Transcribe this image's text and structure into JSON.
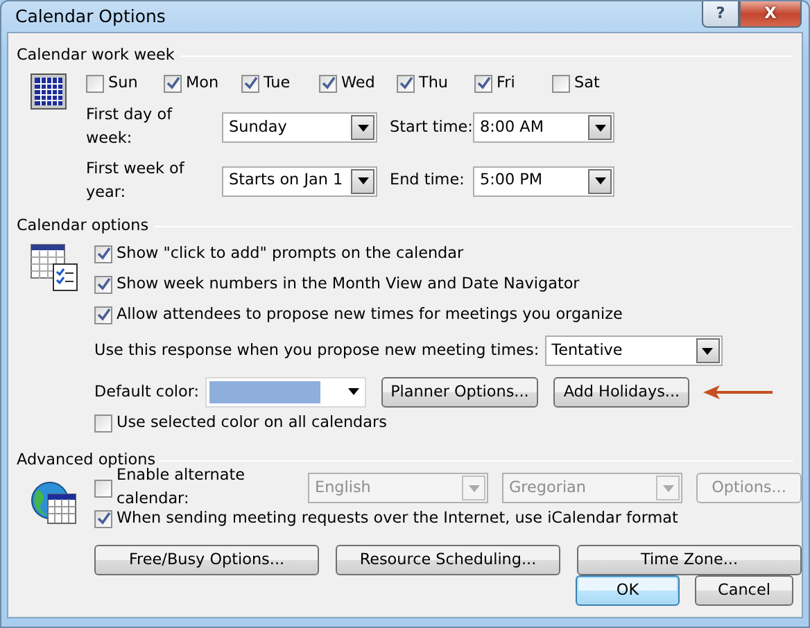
{
  "window": {
    "title": "Calendar Options",
    "help_glyph": "?",
    "close_glyph": "X"
  },
  "work_week": {
    "title": "Calendar work week",
    "days": [
      {
        "label": "Sun",
        "checked": false
      },
      {
        "label": "Mon",
        "checked": true
      },
      {
        "label": "Tue",
        "checked": true
      },
      {
        "label": "Wed",
        "checked": true
      },
      {
        "label": "Thu",
        "checked": true
      },
      {
        "label": "Fri",
        "checked": true
      },
      {
        "label": "Sat",
        "checked": false
      }
    ],
    "fields": [
      {
        "label": "First day of week:",
        "value": "Sunday"
      },
      {
        "label": "Start time:",
        "value": "8:00 AM"
      },
      {
        "label": "First week of year:",
        "value": "Starts on Jan 1"
      },
      {
        "label": "End time:",
        "value": "5:00 PM"
      }
    ]
  },
  "calendar_options": {
    "title": "Calendar options",
    "checks": [
      {
        "label": "Show \"click to add\" prompts on the calendar",
        "checked": true
      },
      {
        "label": "Show week numbers in the Month View and Date Navigator",
        "checked": true
      },
      {
        "label": "Allow attendees to propose new times for meetings you organize",
        "checked": true
      }
    ],
    "response": {
      "label": "Use this response when you propose new meeting times:",
      "value": "Tentative"
    },
    "default_color": {
      "label": "Default color:",
      "color": "#8eaedc"
    },
    "buttons": [
      "Planner Options...",
      "Add Holidays..."
    ],
    "use_selected": {
      "label": "Use selected color on all calendars",
      "checked": false
    }
  },
  "advanced": {
    "title": "Advanced options",
    "alternate": {
      "label": "Enable alternate calendar:",
      "checked": false,
      "disabled": true,
      "language": "English",
      "calendar": "Gregorian",
      "options_button": "Options..."
    },
    "icalendar": {
      "label": "When sending meeting requests over the Internet, use iCalendar format",
      "checked": true
    },
    "buttons": [
      "Free/Busy Options...",
      "Resource Scheduling...",
      "Time Zone..."
    ]
  },
  "footer": [
    {
      "label": "OK",
      "default": true
    },
    {
      "label": "Cancel",
      "default": false
    }
  ]
}
